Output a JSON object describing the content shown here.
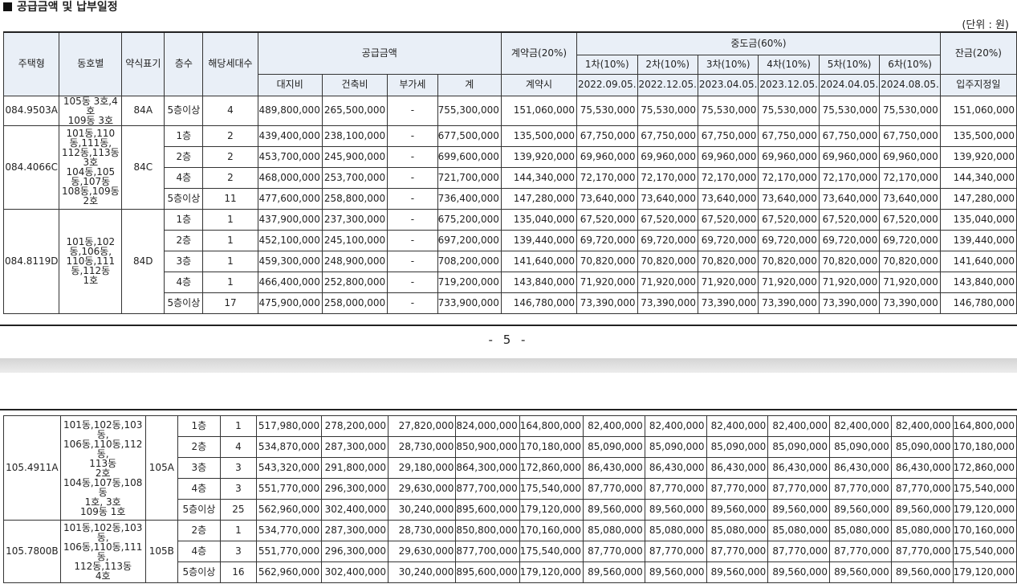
{
  "title": "공급금액 및 납부일정",
  "unit": "(단위 : 원)",
  "page_number": "- 5 -",
  "headers": {
    "housing_type": "주택형",
    "building": "동호별",
    "abbr": "약식표기",
    "floor": "층수",
    "units": "해당세대수",
    "supply": "공급금액",
    "land": "대지비",
    "build": "건축비",
    "vat": "부가세",
    "total": "계",
    "contract": "계약금(20%)",
    "contract_sub": "계약시",
    "middle": "중도금(60%)",
    "m1": "1차(10%)",
    "m2": "2차(10%)",
    "m3": "3차(10%)",
    "m4": "4차(10%)",
    "m5": "5차(10%)",
    "m6": "6차(10%)",
    "d1": "2022.09.05.",
    "d2": "2022.12.05.",
    "d3": "2023.04.05.",
    "d4": "2023.12.05.",
    "d5": "2024.04.05.",
    "d6": "2024.08.05.",
    "balance": "잔금(20%)",
    "balance_sub": "입주지정일"
  },
  "table1": {
    "groups": [
      {
        "type": "084.9503A",
        "building": "105동 3호,4호\n109동 3호",
        "abbr": "84A",
        "rows": [
          {
            "floor": "5층이상",
            "units": "4",
            "land": "489,800,000",
            "build": "265,500,000",
            "vat": "-",
            "total": "755,300,000",
            "contract": "151,060,000",
            "m": "75,530,000",
            "balance": "151,060,000"
          }
        ]
      },
      {
        "type": "084.4066C",
        "building": "101동,110동,111동,\n112동,113동\n3호\n104동,105동,107동\n108동,109동\n2호",
        "abbr": "84C",
        "rows": [
          {
            "floor": "1층",
            "units": "2",
            "land": "439,400,000",
            "build": "238,100,000",
            "vat": "-",
            "total": "677,500,000",
            "contract": "135,500,000",
            "m": "67,750,000",
            "balance": "135,500,000"
          },
          {
            "floor": "2층",
            "units": "2",
            "land": "453,700,000",
            "build": "245,900,000",
            "vat": "-",
            "total": "699,600,000",
            "contract": "139,920,000",
            "m": "69,960,000",
            "balance": "139,920,000"
          },
          {
            "floor": "4층",
            "units": "2",
            "land": "468,000,000",
            "build": "253,700,000",
            "vat": "-",
            "total": "721,700,000",
            "contract": "144,340,000",
            "m": "72,170,000",
            "balance": "144,340,000"
          },
          {
            "floor": "5층이상",
            "units": "11",
            "land": "477,600,000",
            "build": "258,800,000",
            "vat": "-",
            "total": "736,400,000",
            "contract": "147,280,000",
            "m": "73,640,000",
            "balance": "147,280,000"
          }
        ]
      },
      {
        "type": "084.8119D",
        "building": "101동,102동,106동,\n110동,111동,112동\n1호",
        "abbr": "84D",
        "rows": [
          {
            "floor": "1층",
            "units": "1",
            "land": "437,900,000",
            "build": "237,300,000",
            "vat": "-",
            "total": "675,200,000",
            "contract": "135,040,000",
            "m": "67,520,000",
            "balance": "135,040,000"
          },
          {
            "floor": "2층",
            "units": "1",
            "land": "452,100,000",
            "build": "245,100,000",
            "vat": "-",
            "total": "697,200,000",
            "contract": "139,440,000",
            "m": "69,720,000",
            "balance": "139,440,000"
          },
          {
            "floor": "3층",
            "units": "1",
            "land": "459,300,000",
            "build": "248,900,000",
            "vat": "-",
            "total": "708,200,000",
            "contract": "141,640,000",
            "m": "70,820,000",
            "balance": "141,640,000"
          },
          {
            "floor": "4층",
            "units": "1",
            "land": "466,400,000",
            "build": "252,800,000",
            "vat": "-",
            "total": "719,200,000",
            "contract": "143,840,000",
            "m": "71,920,000",
            "balance": "143,840,000"
          },
          {
            "floor": "5층이상",
            "units": "17",
            "land": "475,900,000",
            "build": "258,000,000",
            "vat": "-",
            "total": "733,900,000",
            "contract": "146,780,000",
            "m": "73,390,000",
            "balance": "146,780,000"
          }
        ]
      }
    ]
  },
  "table2": {
    "groups": [
      {
        "type": "105.4911A",
        "building": "101동,102동,103동,\n106동,110동,112동,\n113동\n2호\n104동,107동,108동\n1호, 3호\n109동 1호",
        "abbr": "105A",
        "rows": [
          {
            "floor": "1층",
            "units": "1",
            "land": "517,980,000",
            "build": "278,200,000",
            "vat": "27,820,000",
            "total": "824,000,000",
            "contract": "164,800,000",
            "m": "82,400,000",
            "balance": "164,800,000"
          },
          {
            "floor": "2층",
            "units": "4",
            "land": "534,870,000",
            "build": "287,300,000",
            "vat": "28,730,000",
            "total": "850,900,000",
            "contract": "170,180,000",
            "m": "85,090,000",
            "balance": "170,180,000"
          },
          {
            "floor": "3층",
            "units": "3",
            "land": "543,320,000",
            "build": "291,800,000",
            "vat": "29,180,000",
            "total": "864,300,000",
            "contract": "172,860,000",
            "m": "86,430,000",
            "balance": "172,860,000"
          },
          {
            "floor": "4층",
            "units": "3",
            "land": "551,770,000",
            "build": "296,300,000",
            "vat": "29,630,000",
            "total": "877,700,000",
            "contract": "175,540,000",
            "m": "87,770,000",
            "balance": "175,540,000"
          },
          {
            "floor": "5층이상",
            "units": "25",
            "land": "562,960,000",
            "build": "302,400,000",
            "vat": "30,240,000",
            "total": "895,600,000",
            "contract": "179,120,000",
            "m": "89,560,000",
            "balance": "179,120,000"
          }
        ]
      },
      {
        "type": "105.7800B",
        "building": "101동,102동,103동,\n106동,110동,111동,\n112동,113동\n4호",
        "abbr": "105B",
        "rows": [
          {
            "floor": "2층",
            "units": "1",
            "land": "534,770,000",
            "build": "287,300,000",
            "vat": "28,730,000",
            "total": "850,800,000",
            "contract": "170,160,000",
            "m": "85,080,000",
            "balance": "170,160,000"
          },
          {
            "floor": "4층",
            "units": "3",
            "land": "551,770,000",
            "build": "296,300,000",
            "vat": "29,630,000",
            "total": "877,700,000",
            "contract": "175,540,000",
            "m": "87,770,000",
            "balance": "175,540,000"
          },
          {
            "floor": "5층이상",
            "units": "16",
            "land": "562,960,000",
            "build": "302,400,000",
            "vat": "30,240,000",
            "total": "895,600,000",
            "contract": "179,120,000",
            "m": "89,560,000",
            "balance": "179,120,000"
          }
        ]
      }
    ]
  }
}
